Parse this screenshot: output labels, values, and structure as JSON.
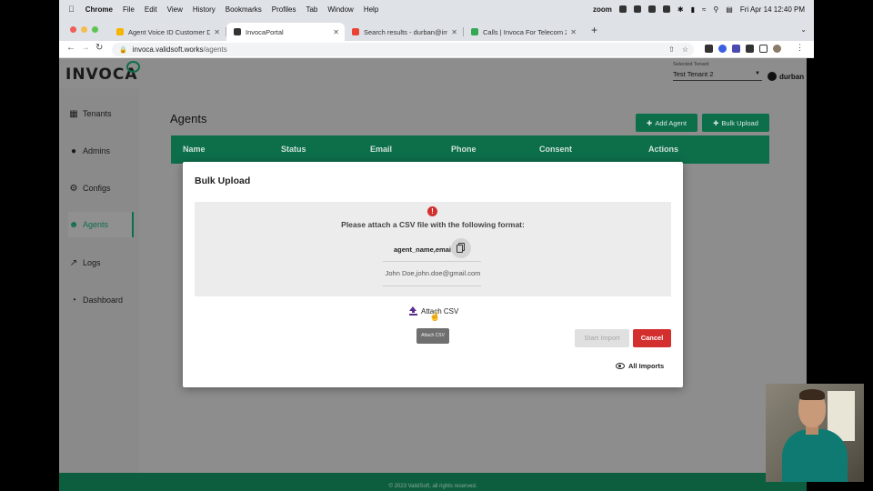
{
  "menubar": {
    "app": "Chrome",
    "items": [
      "File",
      "Edit",
      "View",
      "History",
      "Bookmarks",
      "Profiles",
      "Tab",
      "Window",
      "Help"
    ],
    "zoom_label": "zoom",
    "datetime": "Fri Apr 14  12:40 PM"
  },
  "tabs": [
    {
      "label": "Agent Voice ID Customer Deck",
      "favicon_color": "#f4b400",
      "active": false
    },
    {
      "label": "InvocaPortal",
      "favicon_color": "#333333",
      "active": true
    },
    {
      "label": "Search results - durban@invoca",
      "favicon_color": "#ea4335",
      "active": false
    },
    {
      "label": "Calls | Invoca For Telecom 2.0",
      "favicon_color": "#34a853",
      "active": false
    }
  ],
  "address": {
    "host": "invoca.validsoft.works",
    "path": "/agents"
  },
  "app": {
    "logo": "INVOCA",
    "tenant_label": "Selected Tenant",
    "tenant_value": "Test Tenant 2",
    "username": "durban"
  },
  "sidebar": {
    "items": [
      {
        "label": "Tenants",
        "icon": "building-icon"
      },
      {
        "label": "Admins",
        "icon": "people-icon"
      },
      {
        "label": "Configs",
        "icon": "gear-icon"
      },
      {
        "label": "Agents",
        "icon": "agent-face-icon",
        "active": true
      },
      {
        "label": "Logs",
        "icon": "trend-line-icon"
      },
      {
        "label": "Dashboard",
        "icon": "pie-chart-icon"
      }
    ]
  },
  "main": {
    "title": "Agents",
    "add_agent_label": "Add Agent",
    "bulk_upload_label": "Bulk Upload",
    "columns": [
      "Name",
      "Status",
      "Email",
      "Phone",
      "Consent",
      "Actions"
    ]
  },
  "modal": {
    "title": "Bulk Upload",
    "error_icon": "!",
    "format_text": "Please attach a CSV file with the following format:",
    "format_header": "agent_name,email",
    "format_example": "John Doe,john.doe@gmail.com",
    "attach_label": "Attach CSV",
    "tooltip": "Attach CSV",
    "start_import_label": "Start Import",
    "cancel_label": "Cancel",
    "all_imports_label": "All Imports"
  },
  "footer": {
    "text": "© 2023 ValidSoft, all rights reserved."
  },
  "colors": {
    "brand_green": "#0d6e4a",
    "danger_red": "#d32f2f",
    "attach_purple": "#5c2d91"
  }
}
